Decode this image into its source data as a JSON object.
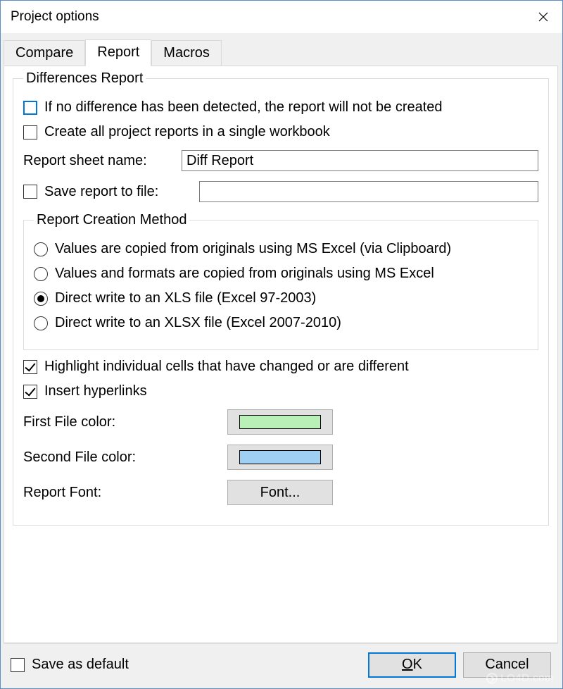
{
  "window": {
    "title": "Project options"
  },
  "tabs": {
    "compare": "Compare",
    "report": "Report",
    "macros": "Macros",
    "active": "report"
  },
  "differences_report": {
    "legend": "Differences Report",
    "no_diff_label": "If no difference has been detected, the report will not be created",
    "single_workbook_label": "Create all project reports in a single workbook",
    "report_sheet_name_label": "Report sheet name:",
    "report_sheet_name_value": "Diff Report",
    "save_to_file_label": "Save report to file:",
    "save_to_file_value": "",
    "creation_method": {
      "legend": "Report Creation Method",
      "opt1": "Values are copied from originals using MS Excel (via Clipboard)",
      "opt2": "Values and formats are copied from originals using MS Excel",
      "opt3": "Direct write to an XLS file (Excel 97-2003)",
      "opt4": "Direct write to an XLSX file (Excel 2007-2010)",
      "selected": "opt3"
    },
    "highlight_cells_label": "Highlight individual cells that have changed or are different",
    "insert_hyperlinks_label": "Insert hyperlinks",
    "first_file_color_label": "First File color:",
    "first_file_color": "#b8f0b8",
    "second_file_color_label": "Second File color:",
    "second_file_color": "#9fcff3",
    "report_font_label": "Report Font:",
    "font_button": "Font..."
  },
  "bottom": {
    "save_as_default": "Save as default",
    "ok_prefix": "",
    "ok_mnemonic": "O",
    "ok_suffix": "K",
    "cancel": "Cancel"
  },
  "watermark": "LO4D.com"
}
